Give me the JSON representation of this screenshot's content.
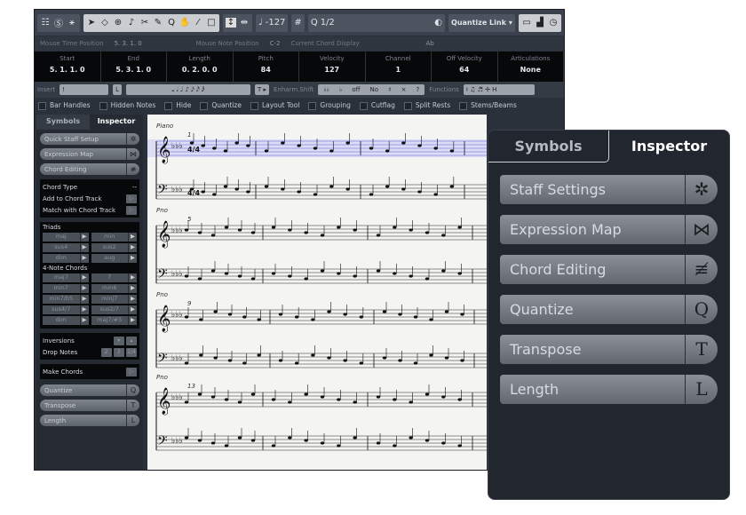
{
  "toolbar": {
    "velocity": "-127",
    "quantize": "1/2",
    "quantize_link": "Quantize Link"
  },
  "mouse_info": {
    "time_label": "Mouse Time Position",
    "time_value": "5. 3. 1.   0",
    "note_label": "Mouse Note Position",
    "note_value": "C-2",
    "chord_label": "Current Chord Display",
    "chord_value": "Ab"
  },
  "event_info": [
    {
      "label": "Start",
      "value": "5. 1. 1.   0"
    },
    {
      "label": "End",
      "value": "5. 3. 1.   0"
    },
    {
      "label": "Length",
      "value": "0. 2. 0.   0"
    },
    {
      "label": "Pitch",
      "value": "84"
    },
    {
      "label": "Velocity",
      "value": "127"
    },
    {
      "label": "Channel",
      "value": "1"
    },
    {
      "label": "Off Velocity",
      "value": "64"
    },
    {
      "label": "Articulations",
      "value": "None"
    }
  ],
  "insert_row": {
    "insert": "Insert",
    "enharm": "Enharm.Shift",
    "functions": "Functions",
    "enharm_off": "off",
    "enharm_no": "No"
  },
  "checkboxes": [
    "Bar Handles",
    "Hidden Notes",
    "Hide",
    "Quantize",
    "Layout Tool",
    "Grouping",
    "Cutflag",
    "Split Rests",
    "Stems/Beams"
  ],
  "left_panel": {
    "tabs": [
      "Symbols",
      "Inspector"
    ],
    "top_buttons": [
      {
        "label": "Quick Staff Setup",
        "icon": "gear-icon",
        "glyph": "✲"
      },
      {
        "label": "Expression Map",
        "icon": "bowtie-icon",
        "glyph": "⋈"
      },
      {
        "label": "Chord Editing",
        "icon": "chord-icon",
        "glyph": "≢"
      }
    ],
    "chord_type": "Chord Type",
    "chord_type_value": "--",
    "add_track": "Add to Chord Track",
    "match_track": "Match with Chord Track",
    "triads_label": "Triads",
    "triads": [
      "maj",
      "min",
      "sus4",
      "sus2",
      "dim",
      "aug"
    ],
    "four_note_label": "4-Note Chords",
    "four_note": [
      "maj7",
      "7",
      "min7",
      "min6",
      "min7/b5",
      "minj7",
      "sus4/7",
      "sus2/7",
      "dim",
      "maj7/#5"
    ],
    "inversions": "Inversions",
    "drop_notes": "Drop Notes",
    "drop": [
      "2",
      "3",
      "2/4"
    ],
    "make_chords": "Make Chords",
    "bottom_buttons": [
      {
        "label": "Quantize",
        "glyph": "Q"
      },
      {
        "label": "Transpose",
        "glyph": "T"
      },
      {
        "label": "Length",
        "glyph": "L"
      }
    ]
  },
  "score": {
    "systems": [
      {
        "label": "Piano",
        "bar": "1"
      },
      {
        "label": "Pno",
        "bar": "5"
      },
      {
        "label": "Pno",
        "bar": "9"
      },
      {
        "label": "Pno",
        "bar": "13"
      }
    ],
    "time_signature": "4/4",
    "key": "Eb major",
    "selection_color": "#5a5ad8"
  },
  "right_panel": {
    "tabs": [
      "Symbols",
      "Inspector"
    ],
    "buttons": [
      {
        "label": "Staff Settings",
        "glyph": "✲"
      },
      {
        "label": "Expression Map",
        "glyph": "⋈"
      },
      {
        "label": "Chord Editing",
        "glyph": "≢"
      },
      {
        "label": "Quantize",
        "glyph": "Q"
      },
      {
        "label": "Transpose",
        "glyph": "T"
      },
      {
        "label": "Length",
        "glyph": "L"
      }
    ]
  }
}
